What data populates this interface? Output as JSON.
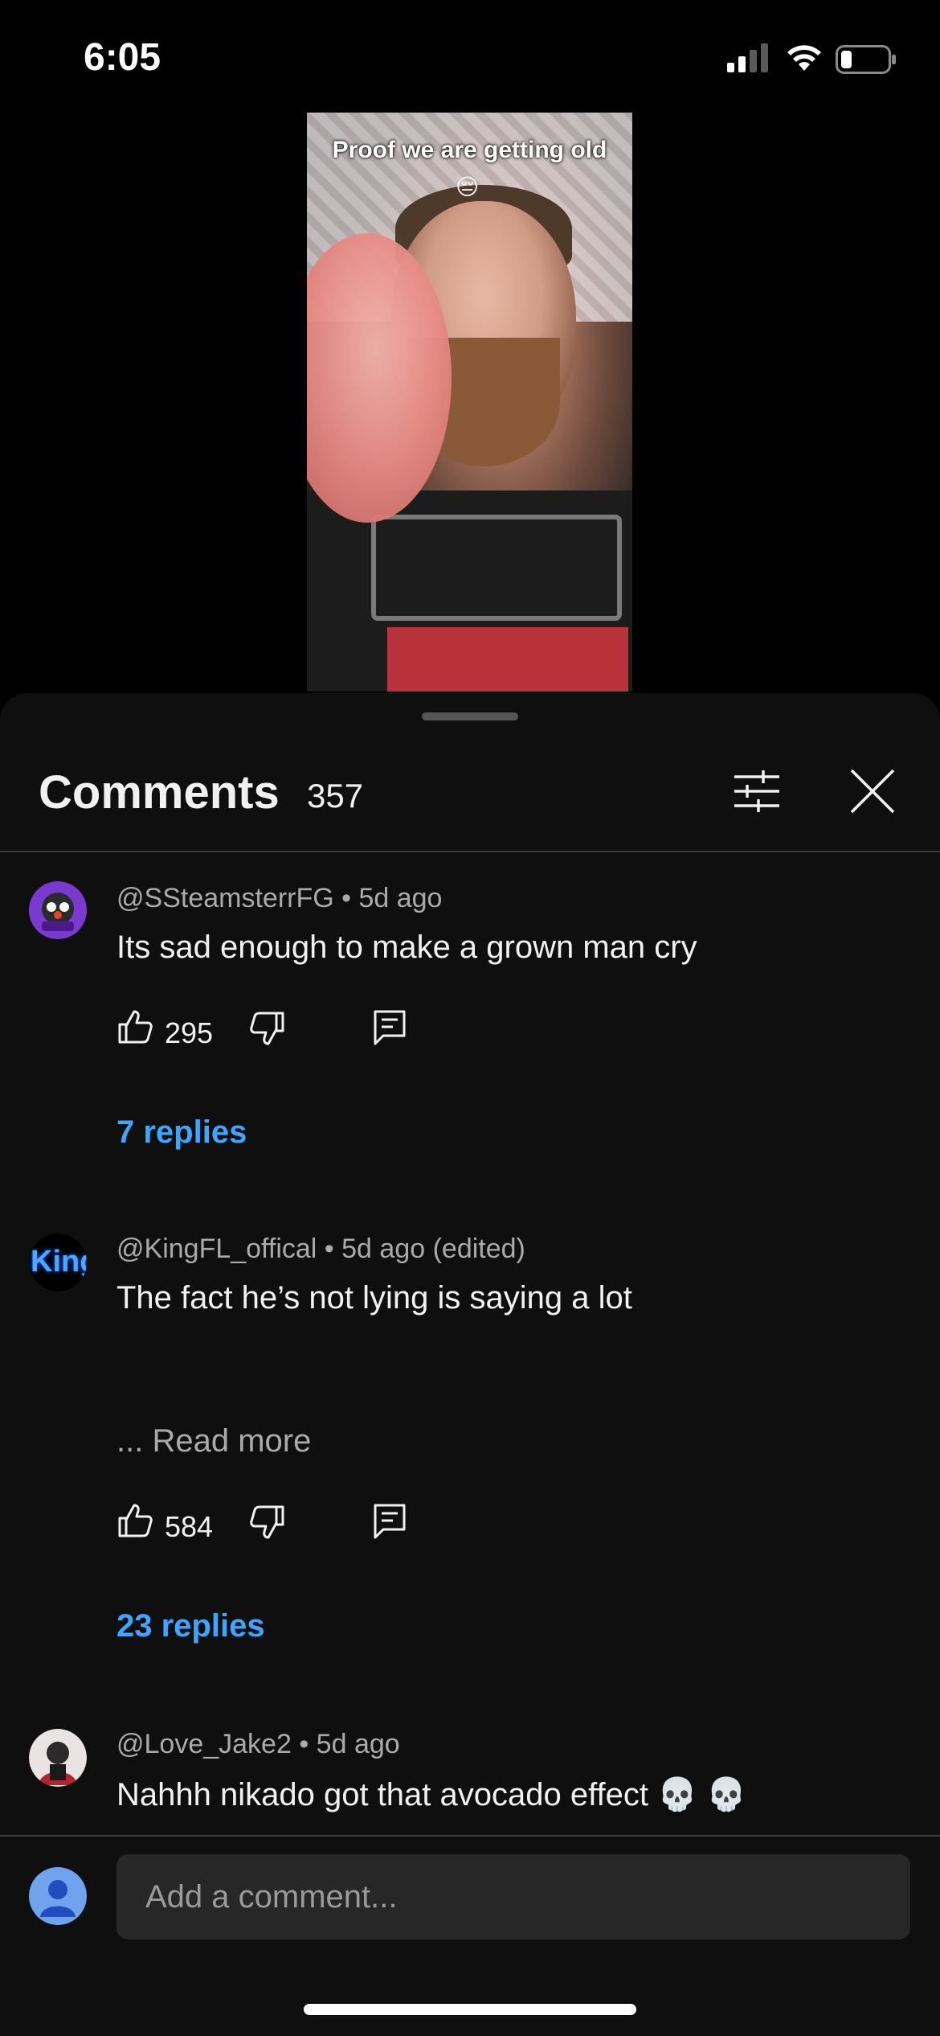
{
  "status_bar": {
    "time": "6:05"
  },
  "video": {
    "caption": "Proof we are getting old",
    "caption_emoji": "😔"
  },
  "comments_panel": {
    "title": "Comments",
    "count": "357",
    "comments": [
      {
        "author": "@SSteamsterrFG",
        "age": "5d ago",
        "meta": "@SSteamsterrFG • 5d ago",
        "text": "Its sad enough to make a grown man cry",
        "likes": "295",
        "replies_label": "7 replies"
      },
      {
        "author": "@KingFL_offical",
        "age": "5d ago (edited)",
        "meta": "@KingFL_offical • 5d ago (edited)",
        "text": "The fact he’s not lying is saying a lot",
        "read_more": "... Read more",
        "likes": "584",
        "replies_label": "23 replies",
        "avatar_text": "King"
      },
      {
        "author": "@Love_Jake2",
        "age": "5d ago",
        "meta": "@Love_Jake2 • 5d ago",
        "text": "Nahhh nikado got that avocado effect 💀 💀"
      }
    ],
    "add_comment_placeholder": "Add a comment..."
  },
  "colors": {
    "background": "#0f0f0f",
    "link_blue": "#3ea6ff",
    "secondary_text": "#aaaaaa"
  }
}
